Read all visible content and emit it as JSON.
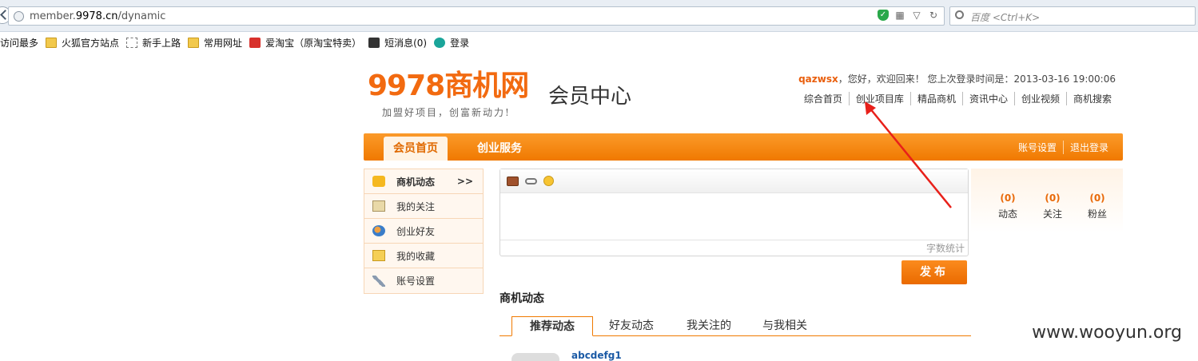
{
  "browser": {
    "url_prefix": "member.",
    "url_domain": "9978.cn",
    "url_path": "/dynamic",
    "search_placeholder": "百度 <Ctrl+K>"
  },
  "bookmarks": [
    {
      "label": "访问最多",
      "icon": "none"
    },
    {
      "label": "火狐官方站点",
      "icon": "folder-icon"
    },
    {
      "label": "新手上路",
      "icon": "dashed-page-icon"
    },
    {
      "label": "常用网址",
      "icon": "folder-icon"
    },
    {
      "label": "爱淘宝（原淘宝特卖）",
      "icon": "taobao-icon"
    },
    {
      "label": "短消息(0)",
      "icon": "message-icon"
    },
    {
      "label": "登录",
      "icon": "login-icon"
    }
  ],
  "header": {
    "logo_text": "9978商机网",
    "slogan": "加盟好项目，创富新动力!",
    "center_title": "会员中心",
    "username": "qazwsx",
    "welcome_text": "，您好，欢迎回来！  您上次登录时间是：2013-03-16 19:00:06",
    "links": [
      "综合首页",
      "创业项目库",
      "精品商机",
      "资讯中心",
      "创业视频",
      "商机搜索"
    ]
  },
  "nav": {
    "tab_home": "会员首页",
    "tab_service": "创业服务",
    "account_settings": "账号设置",
    "logout": "退出登录"
  },
  "sidebar": {
    "items": [
      {
        "label": "商机动态",
        "icon": "chat-bubble-icon",
        "active": true
      },
      {
        "label": "我的关注",
        "icon": "card-icon"
      },
      {
        "label": "创业好友",
        "icon": "friends-icon"
      },
      {
        "label": "我的收藏",
        "icon": "favorite-folder-icon"
      },
      {
        "label": "账号设置",
        "icon": "wrench-icon"
      }
    ],
    "active_arrow": ">>"
  },
  "editor": {
    "word_count": "字数统计",
    "publish": "发布"
  },
  "stats": [
    {
      "num": "(0)",
      "label": "动态"
    },
    {
      "num": "(0)",
      "label": "关注"
    },
    {
      "num": "(0)",
      "label": "粉丝"
    }
  ],
  "feed": {
    "title": "商机动态",
    "tabs": [
      "推荐动态",
      "好友动态",
      "我关注的",
      "与我相关"
    ],
    "first_user": "abcdefg1"
  },
  "watermark": "www.wooyun.org",
  "colors": {
    "accent": "#f07900",
    "username": "#e95e0c",
    "annotation_arrow": "#e8201a"
  }
}
